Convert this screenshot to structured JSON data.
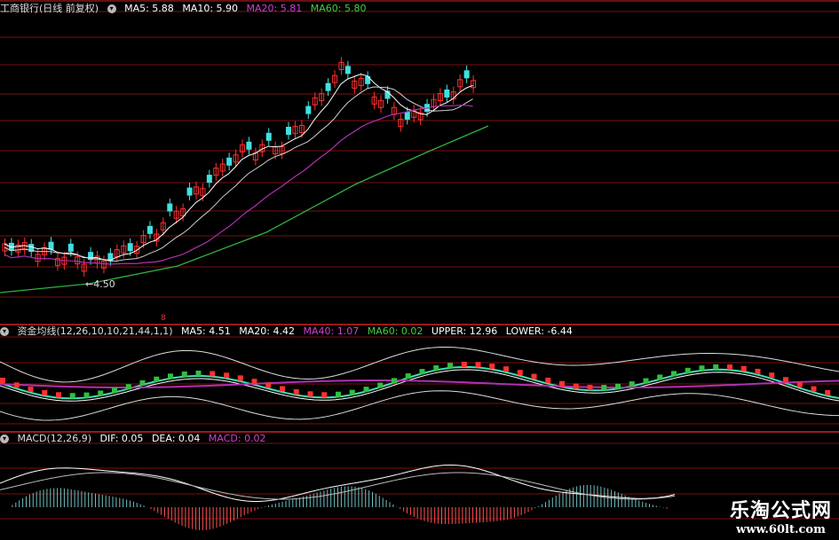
{
  "panel1": {
    "title": "工商银行(日线 前复权)",
    "ma": [
      {
        "label": "MA5: 5.88",
        "color": "#ffffff"
      },
      {
        "label": "MA10: 5.90",
        "color": "#ffffff"
      },
      {
        "label": "MA20: 5.81",
        "color": "#d040d0"
      },
      {
        "label": "MA60: 5.80",
        "color": "#40d040"
      }
    ],
    "low_label": "4.50"
  },
  "panel2": {
    "title": "资金均线(12,26,10,10,21,44,1,1)",
    "items": [
      {
        "label": "MA5: 4.51",
        "color": "#ffffff"
      },
      {
        "label": "MA20: 4.42",
        "color": "#ffffff"
      },
      {
        "label": "MA40: 1.07",
        "color": "#d040d0"
      },
      {
        "label": "MA60: 0.02",
        "color": "#40d040"
      },
      {
        "label": "UPPER: 12.96",
        "color": "#ffffff"
      },
      {
        "label": "LOWER: -6.44",
        "color": "#ffffff"
      }
    ],
    "mark": "8"
  },
  "panel3": {
    "title": "MACD(12,26,9)",
    "items": [
      {
        "label": "DIF: 0.05",
        "color": "#ffffff"
      },
      {
        "label": "DEA: 0.04",
        "color": "#ffffff"
      },
      {
        "label": "MACD: 0.02",
        "color": "#d040d0"
      }
    ]
  },
  "watermark": {
    "cn": "乐淘公式网",
    "url": "www.60lt.com"
  },
  "colors": {
    "up": "#ff3030",
    "down": "#40e0e0",
    "ma60": "#30b040",
    "ma20": "#b030b0",
    "divider": "#c02020"
  }
}
